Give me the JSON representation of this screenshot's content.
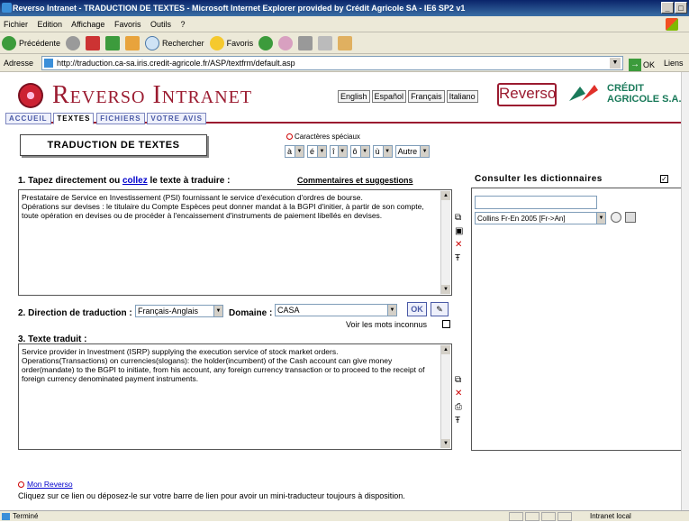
{
  "window": {
    "title": "Reverso Intranet - TRADUCTION DE TEXTES - Microsoft Internet Explorer provided by Crédit Agricole SA - IE6 SP2 v1"
  },
  "menu": [
    "Fichier",
    "Edition",
    "Affichage",
    "Favoris",
    "Outils",
    "?"
  ],
  "toolbar": {
    "back": "Précédente",
    "search": "Rechercher",
    "favorites": "Favoris"
  },
  "address": {
    "label": "Adresse",
    "url": "http://traduction.ca-sa.iris.credit-agricole.fr/ASP/textfrm/default.asp",
    "go": "OK",
    "links": "Liens"
  },
  "brand": {
    "title": "Reverso Intranet",
    "reverso_logo": "Reverso",
    "ca_line1": "CRÉDIT",
    "ca_line2": "AGRICOLE S.A."
  },
  "languages": [
    "English",
    "Español",
    "Français",
    "Italiano"
  ],
  "tabs": [
    "ACCUEIL",
    "TEXTES",
    "FICHIERS",
    "VOTRE AVIS"
  ],
  "main": {
    "title": "TRADUCTION DE TEXTES",
    "special_chars_label": "Caractères spéciaux",
    "special_chars": [
      "à",
      "é",
      "î",
      "ô",
      "ù",
      "Autre"
    ],
    "step1_prefix": "1. Tapez directement ou ",
    "step1_link": "collez",
    "step1_suffix": " le texte à traduire :",
    "comments_link": "Commentaires et suggestions",
    "source_text": "Prestataire de Service en Investissement (PSI) fournissant le service d'exécution  d'ordres de bourse.\nOpérations sur devises : le titulaire du Compte Espèces peut donner mandat à la BGPI d'initier, à partir de son compte, toute opération en devises ou de procéder à l'encaissement d'instruments de paiement libellés en devises.",
    "step2_label": "2. Direction de traduction :",
    "direction_value": "Français-Anglais",
    "domain_label": "Domaine :",
    "domain_value": "CASA",
    "ok_label": "OK",
    "unknown_words_label": "Voir les mots inconnus",
    "step3_label": "3. Texte traduit :",
    "target_text": "Service provider in Investment (ISRP) supplying the execution service of stock market orders.\nOperations(Transactions) on currencies(slogans): the holder(incumbent) of the Cash account can give money order(mandate) to the BGPI to initiate, from his account, any foreign currency transaction or to proceed to the receipt of foreign currency denominated payment instruments."
  },
  "dictionary": {
    "title": "Consulter les dictionnaires",
    "select_value": "Collins Fr-En 2005 [Fr->An]"
  },
  "footer": {
    "myreverso": "Mon Reverso",
    "description": "Cliquez sur ce lien ou déposez-le sur votre barre de lien pour avoir un mini-traducteur toujours à disposition."
  },
  "status": {
    "left": "Terminé",
    "zone": "Intranet local"
  }
}
